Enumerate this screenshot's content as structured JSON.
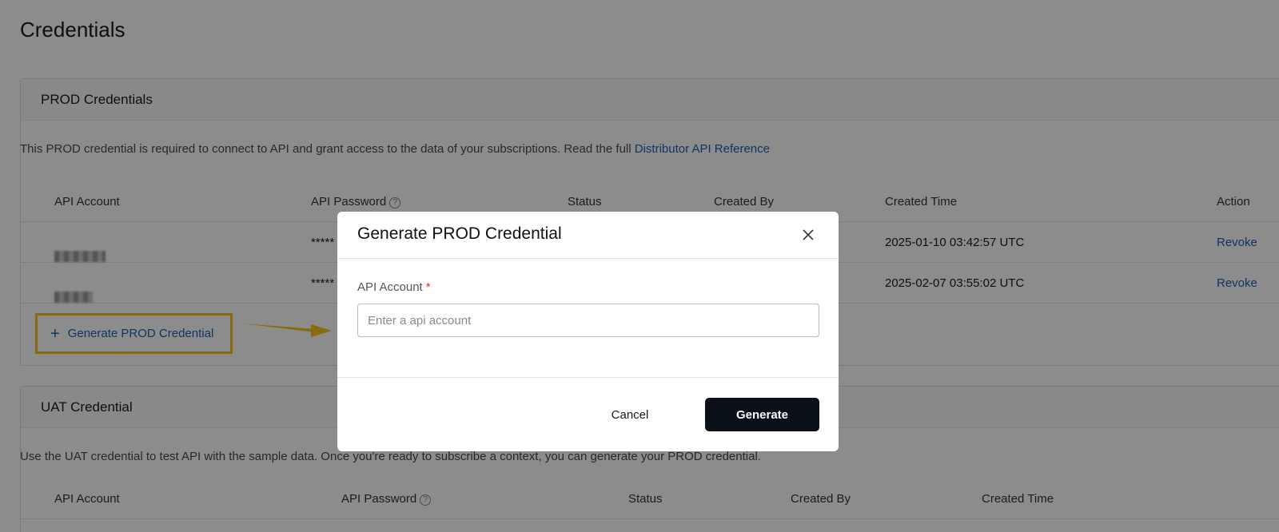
{
  "page": {
    "title": "Credentials"
  },
  "prod": {
    "title": "PROD Credentials",
    "description": "This PROD credential is required to connect to API and grant access to the data of your subscriptions. Read the full ",
    "reference_link": "Distributor API Reference",
    "columns": [
      "API Account",
      "API Password",
      "Status",
      "Created By",
      "Created Time",
      "Action"
    ],
    "help_icon": "question-circle-icon",
    "rows": [
      {
        "password": "*****",
        "created_time": "2025-01-10 03:42:57 UTC",
        "action": "Revoke"
      },
      {
        "password": "*****",
        "created_time": "2025-02-07 03:55:02 UTC",
        "action": "Revoke"
      }
    ],
    "generate_button": "Generate PROD Credential",
    "generate_icon": "+"
  },
  "uat": {
    "title": "UAT Credential",
    "description": "Use the UAT credential to test API with the sample data. Once you're ready to subscribe a context, you can generate your PROD credential.",
    "columns": [
      "API Account",
      "API Password",
      "Status",
      "Created By",
      "Created Time"
    ]
  },
  "modal": {
    "title": "Generate PROD Credential",
    "close_icon": "close-icon",
    "field_label": "API Account",
    "required_mark": "*",
    "field_placeholder": "Enter a api account",
    "field_value": "",
    "cancel_label": "Cancel",
    "generate_label": "Generate"
  },
  "colors": {
    "link": "#1d5fb0",
    "highlight": "#f5c518",
    "primary_button": "#0b1118",
    "overlay": "rgba(0,0,0,0.45)"
  }
}
